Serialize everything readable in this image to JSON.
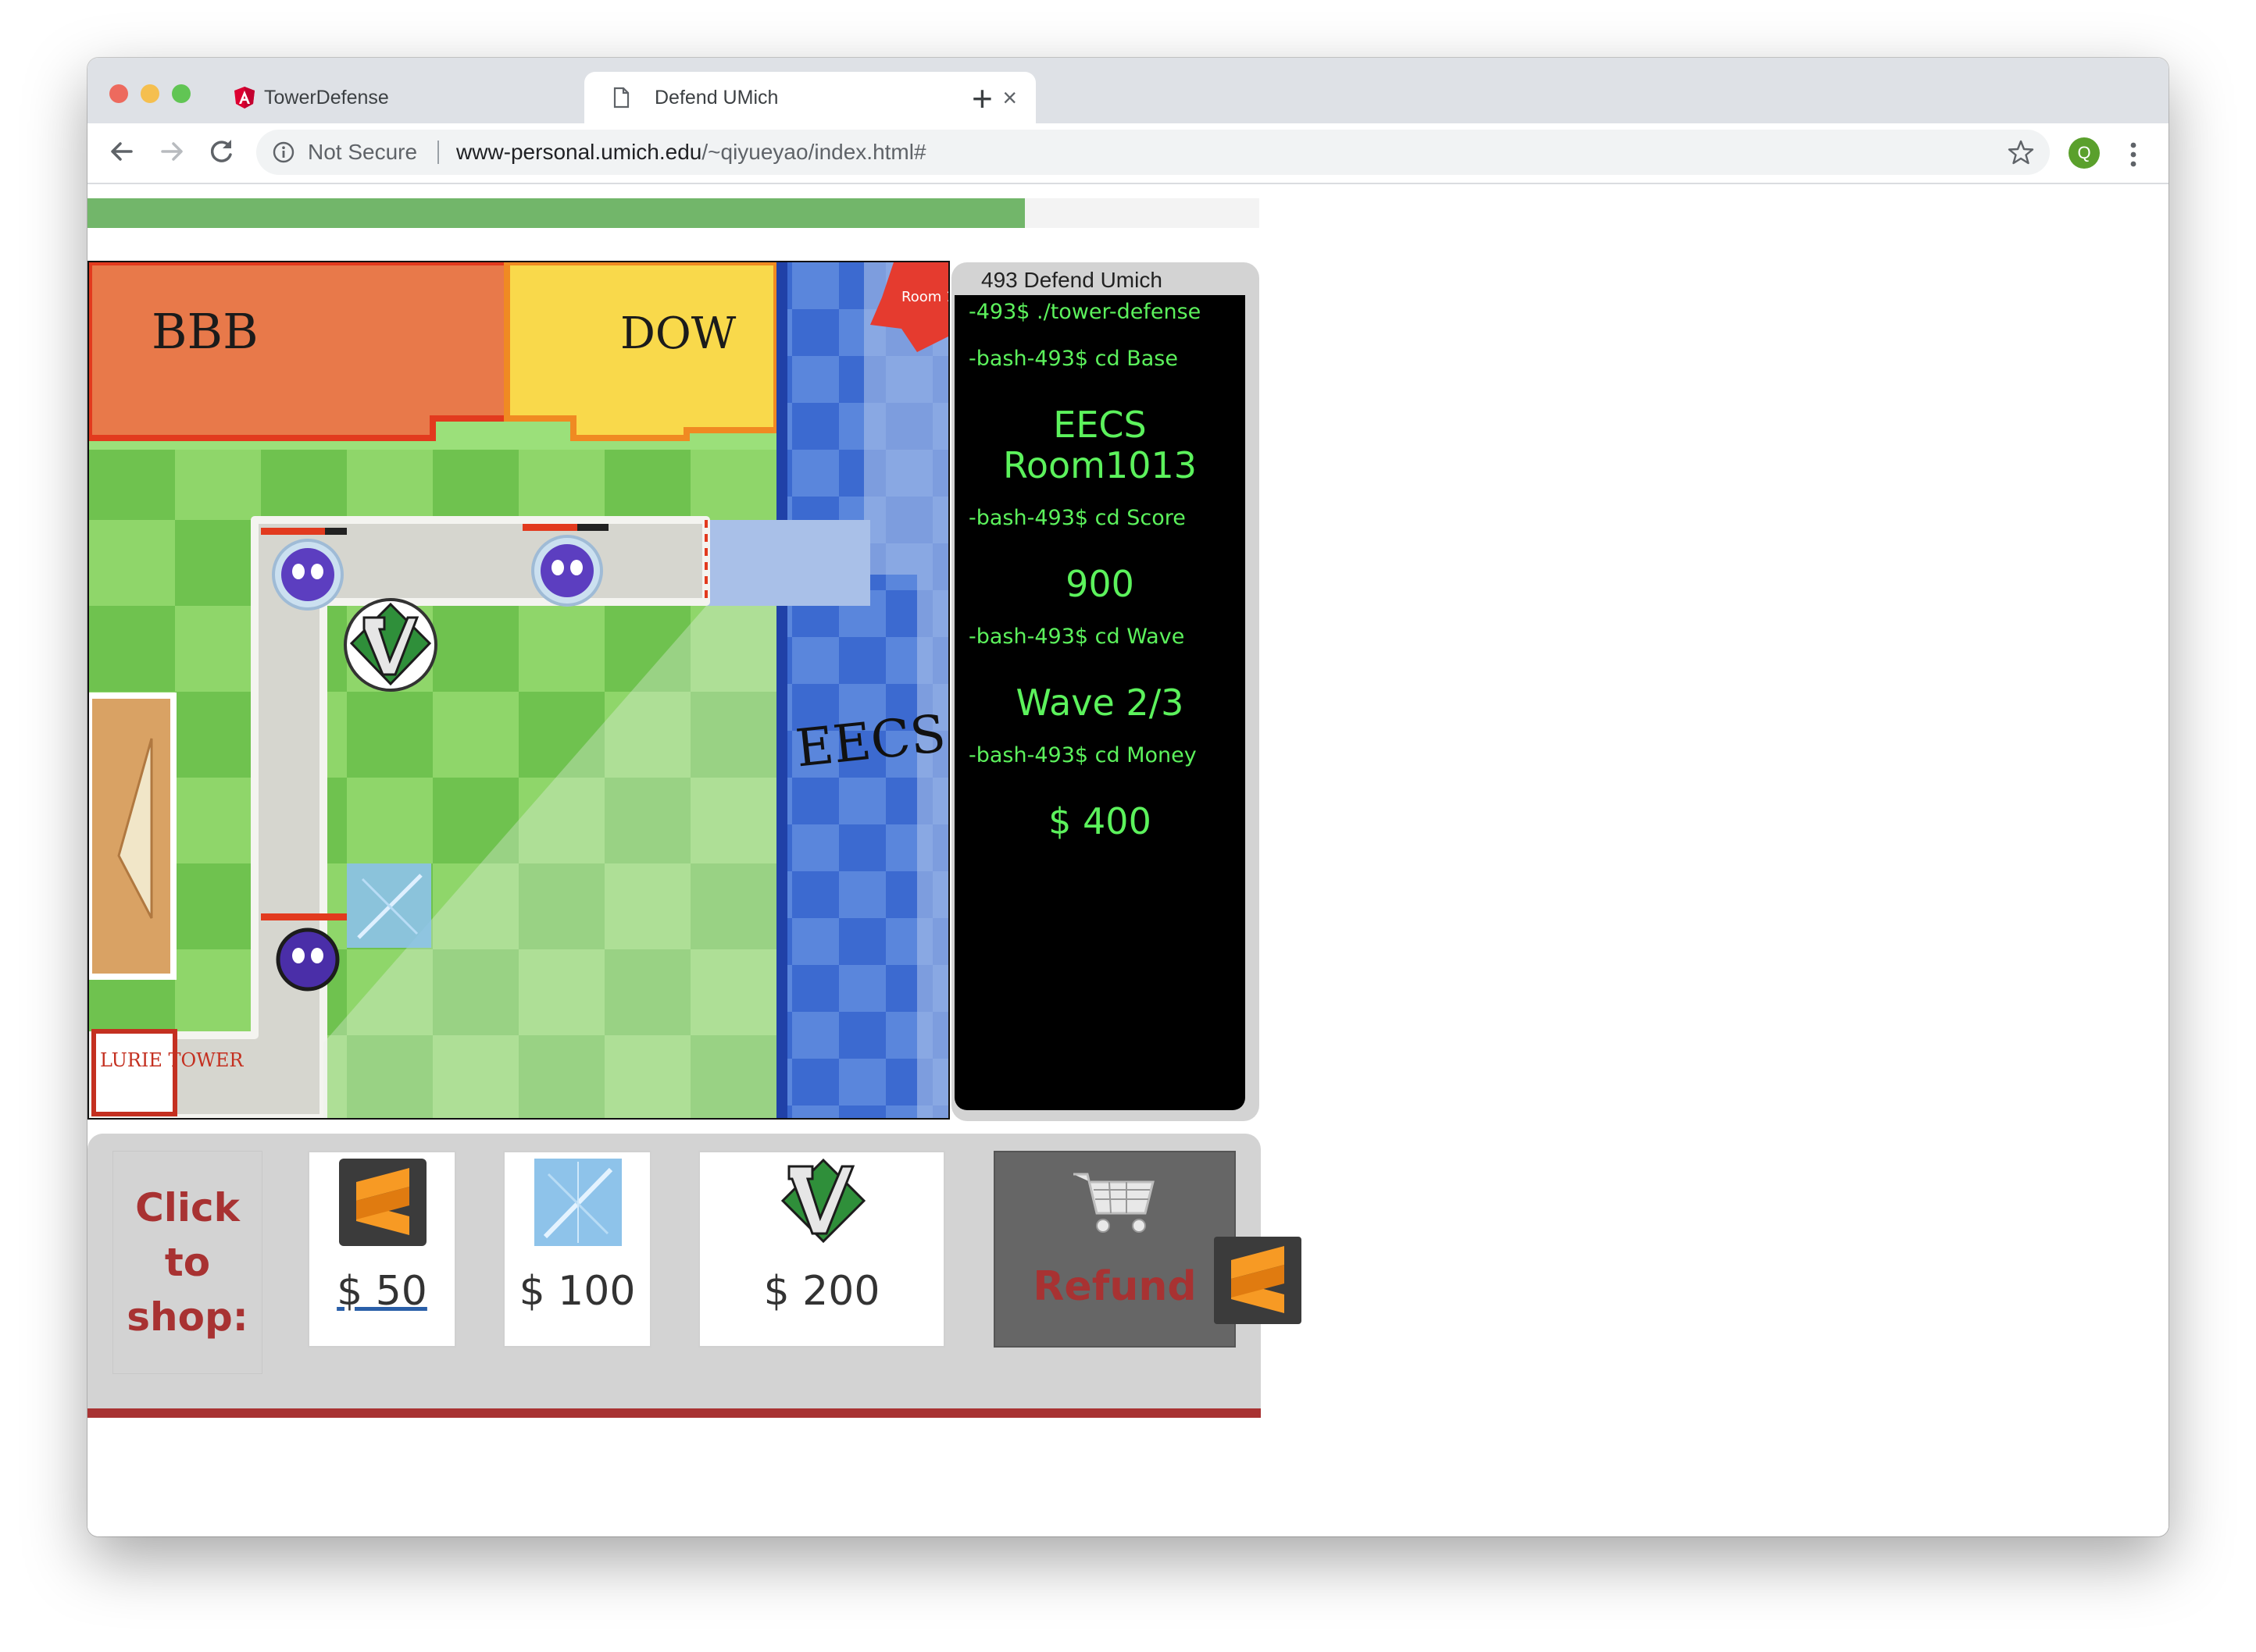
{
  "browser": {
    "tabs": [
      {
        "title": "TowerDefense",
        "icon": "angular-icon"
      },
      {
        "title": "Defend UMich",
        "icon": "page-icon"
      }
    ],
    "security_label": "Not Secure",
    "url_host": "www-personal.umich.edu",
    "url_path": "/~qiyueyao/index.html#",
    "profile_initial": "Q"
  },
  "game": {
    "progress_fraction": 0.8,
    "map_labels": {
      "bbb": "BBB",
      "dow": "DOW",
      "eecs": "EECS",
      "room": "Room 1013",
      "lurie": "LURIE TOWER"
    },
    "terminal": {
      "title": "493 Defend Umich",
      "cmd_start": "-493$ ./tower-defense",
      "cmd_base": "-bash-493$ cd Base",
      "base_line1": "EECS",
      "base_line2": "Room1013",
      "cmd_score": "-bash-493$ cd Score",
      "score": "900",
      "cmd_wave": "-bash-493$ cd Wave",
      "wave": "Wave 2/3",
      "cmd_money": "-bash-493$ cd Money",
      "money": "$ 400"
    },
    "shop": {
      "label_lines": [
        "Click",
        "to",
        "shop:"
      ],
      "items": [
        {
          "price": "$ 50",
          "icon": "sublime-icon"
        },
        {
          "price": "$ 100",
          "icon": "ice-tower-icon"
        },
        {
          "price": "$ 200",
          "icon": "vim-icon"
        }
      ],
      "refund_label": "Refund"
    }
  },
  "colors": {
    "progress": "#72b66a",
    "terminal_text": "#5cf25c",
    "shop_accent": "#a83232"
  }
}
